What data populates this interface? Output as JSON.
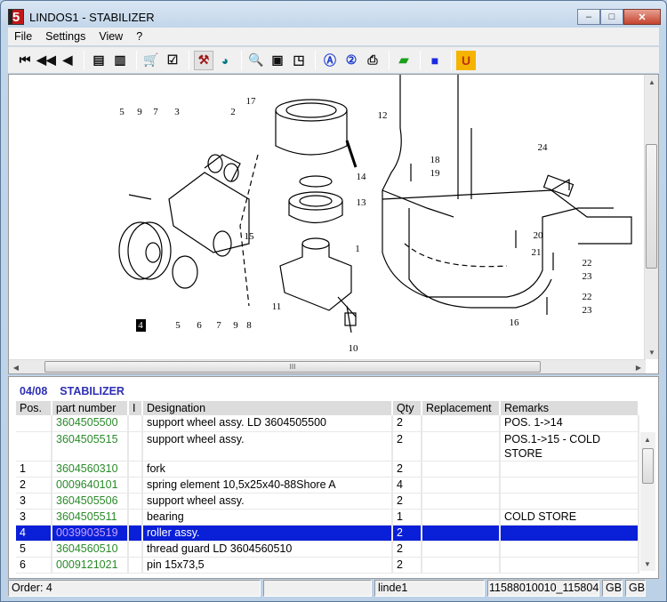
{
  "window": {
    "title": "LINDOS1 - STABILIZER",
    "logo": "5",
    "min": "–",
    "max": "□",
    "close": "✕"
  },
  "menu": [
    "File",
    "Settings",
    "View",
    "?"
  ],
  "toolbar": [
    {
      "icon": "first-icon",
      "glyph": "⏮"
    },
    {
      "icon": "rewind-icon",
      "glyph": "◀◀"
    },
    {
      "icon": "previous-icon",
      "glyph": "◀"
    },
    {
      "icon": "sep"
    },
    {
      "icon": "page-back-icon",
      "glyph": "▤"
    },
    {
      "icon": "page-forward-icon",
      "glyph": "▥"
    },
    {
      "icon": "sep"
    },
    {
      "icon": "cart-icon",
      "glyph": "🛒"
    },
    {
      "icon": "checklist-icon",
      "glyph": "☑"
    },
    {
      "icon": "sep"
    },
    {
      "icon": "link-icon",
      "glyph": "⚒",
      "pressed": true
    },
    {
      "icon": "globe-icon",
      "glyph": "◕"
    },
    {
      "icon": "sep"
    },
    {
      "icon": "zoom-icon",
      "glyph": "🔍"
    },
    {
      "icon": "page-icon",
      "glyph": "▣"
    },
    {
      "icon": "page-corner-icon",
      "glyph": "◳"
    },
    {
      "icon": "sep"
    },
    {
      "icon": "search-a-icon",
      "glyph": "Ⓐ"
    },
    {
      "icon": "search-2-icon",
      "glyph": "②"
    },
    {
      "icon": "print-icon",
      "glyph": "⎙"
    },
    {
      "icon": "sep"
    },
    {
      "icon": "notes-icon",
      "glyph": "▰"
    },
    {
      "icon": "sep"
    },
    {
      "icon": "blue-square-icon",
      "glyph": "■"
    },
    {
      "icon": "sep"
    },
    {
      "icon": "u-icon",
      "glyph": "U"
    }
  ],
  "drawing": {
    "callouts": [
      "5",
      "9",
      "7",
      "3",
      "2",
      "17",
      "12",
      "18",
      "19",
      "14",
      "13",
      "24",
      "15",
      "1",
      "20",
      "21",
      "22",
      "23",
      "22",
      "23",
      "11",
      "4",
      "5",
      "6",
      "7",
      "9",
      "8",
      "10",
      "16"
    ],
    "highlighted": "4",
    "hscroll_grip": "III"
  },
  "parts": {
    "page": "04/08",
    "group": "STABILIZER",
    "columns": [
      "Pos.",
      "part number",
      "I",
      "Designation",
      "Qty",
      "Replacement",
      "Remarks"
    ],
    "rows": [
      {
        "pos": "",
        "part": "3604505500",
        "i": "",
        "designation": "support wheel assy.   LD 3604505500",
        "qty": "2",
        "replacement": "",
        "remarks": "POS. 1->14"
      },
      {
        "pos": "",
        "part": "3604505515",
        "i": "",
        "designation": "support wheel assy.",
        "qty": "2",
        "replacement": "",
        "remarks": "POS.1->15 - COLD STORE"
      },
      {
        "pos": "1",
        "part": "3604560310",
        "i": "",
        "designation": "fork",
        "qty": "2",
        "replacement": "",
        "remarks": ""
      },
      {
        "pos": "2",
        "part": "0009640101",
        "i": "",
        "designation": "spring element 10,5x25x40-88Shore A",
        "qty": "4",
        "replacement": "",
        "remarks": ""
      },
      {
        "pos": "3",
        "part": "3604505506",
        "i": "",
        "designation": "support wheel assy.",
        "qty": "2",
        "replacement": "",
        "remarks": ""
      },
      {
        "pos": "3",
        "part": "3604505511",
        "i": "",
        "designation": "bearing",
        "qty": "1",
        "replacement": "",
        "remarks": "COLD STORE"
      },
      {
        "pos": "4",
        "part": "0039903519",
        "i": "",
        "designation": "roller assy.",
        "qty": "2",
        "replacement": "",
        "remarks": "",
        "selected": true
      },
      {
        "pos": "5",
        "part": "3604560510",
        "i": "",
        "designation": "thread guard   LD 3604560510",
        "qty": "2",
        "replacement": "",
        "remarks": ""
      },
      {
        "pos": "6",
        "part": "0009121021",
        "i": "",
        "designation": "pin 15x73,5",
        "qty": "2",
        "replacement": "",
        "remarks": ""
      }
    ]
  },
  "status": {
    "order": "Order: 4",
    "blank": "",
    "user": "linde1",
    "code": "11588010010_115804",
    "lang1": "GB",
    "lang2": "GB"
  },
  "colors": {
    "selection": "#0a1fd8",
    "part_number": "#2a8a2a",
    "header": "#2e2eb4"
  }
}
